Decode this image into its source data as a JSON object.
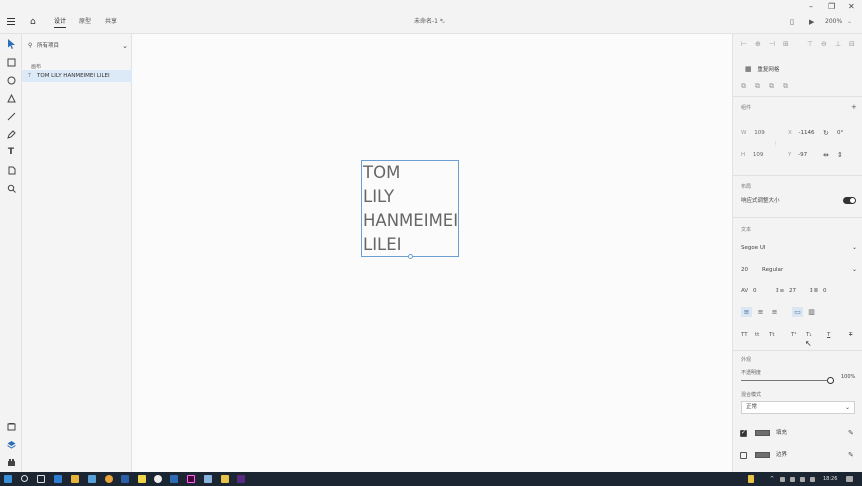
{
  "titlebar": {
    "tabs": [
      "设计",
      "原型",
      "共享"
    ],
    "document_title": "未命名-1 *",
    "zoom": "200%"
  },
  "layers": {
    "scope": "所有项目",
    "group_label": "画布",
    "items": [
      {
        "label": "TOM LILY HANMEIMEI LILEI"
      }
    ]
  },
  "canvas": {
    "text_lines": [
      "TOM",
      "LILY",
      "HANMEIMEI",
      "LILEI"
    ]
  },
  "properties": {
    "repeat_grid": "重复网格",
    "component_label": "组件",
    "w": "109",
    "h": "109",
    "x": "-1146",
    "y": "-97",
    "rotation": "0°",
    "layout_label": "布局",
    "responsive_label": "响应式调整大小",
    "text_label": "文本",
    "font_family": "Segoe UI",
    "font_size": "20",
    "font_weight": "Regular",
    "char_spacing": "0",
    "line_spacing": "27",
    "paragraph_spacing": "0",
    "appearance_label": "外观",
    "opacity_label": "不透明度",
    "opacity_value": "100%",
    "opacity": 1.0,
    "blend_label": "混合模式",
    "blend_value": "正常",
    "fill_label": "填充",
    "border_label": "边界",
    "fill_color": "#6e6e6e"
  },
  "taskbar": {
    "time": "18:26"
  },
  "colors": {
    "selection": "#6b9fd2",
    "layer_highlight": "#dce9f7",
    "taskbar": "#1c2633"
  }
}
